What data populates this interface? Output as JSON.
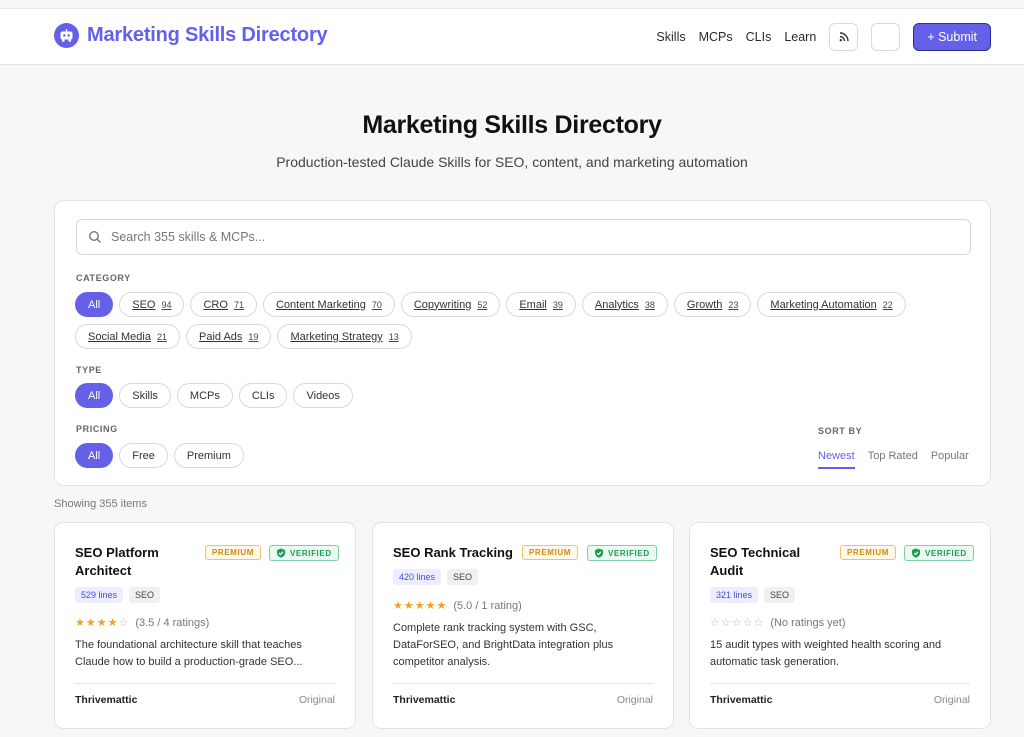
{
  "header": {
    "brand_title": "Marketing Skills Directory",
    "nav": [
      "Skills",
      "MCPs",
      "CLIs",
      "Learn"
    ],
    "rss_icon": "rss-icon",
    "theme_icon": "moon-icon",
    "submit_label": "+ Submit"
  },
  "hero": {
    "title": "Marketing Skills Directory",
    "subtitle": "Production-tested Claude Skills for SEO, content, and marketing automation"
  },
  "search": {
    "placeholder": "Search 355 skills & MCPs..."
  },
  "filters": {
    "category_label": "CATEGORY",
    "categories": [
      {
        "label": "All",
        "count": ""
      },
      {
        "label": "SEO",
        "count": "94"
      },
      {
        "label": "CRO",
        "count": "71"
      },
      {
        "label": "Content Marketing",
        "count": "70"
      },
      {
        "label": "Copywriting",
        "count": "52"
      },
      {
        "label": "Email",
        "count": "39"
      },
      {
        "label": "Analytics",
        "count": "38"
      },
      {
        "label": "Growth",
        "count": "23"
      },
      {
        "label": "Marketing Automation",
        "count": "22"
      },
      {
        "label": "Social Media",
        "count": "21"
      },
      {
        "label": "Paid Ads",
        "count": "19"
      },
      {
        "label": "Marketing Strategy",
        "count": "13"
      }
    ],
    "type_label": "TYPE",
    "types": [
      "All",
      "Skills",
      "MCPs",
      "CLIs",
      "Videos"
    ],
    "pricing_label": "PRICING",
    "pricing": [
      "All",
      "Free",
      "Premium"
    ],
    "sort_label": "SORT BY",
    "sort_options": [
      "Newest",
      "Top Rated",
      "Popular"
    ]
  },
  "showing": "Showing 355 items",
  "colors": {
    "accent": "#6461e8",
    "premium": "#d08a12",
    "verified": "#1f9a55",
    "star": "#f0a020"
  },
  "cards": [
    {
      "title": "SEO Platform Architect",
      "premium": "PREMIUM",
      "verified": "VERIFIED",
      "lines": "529 lines",
      "tag": "SEO",
      "stars": "★★★★",
      "stars_empty": "☆",
      "rating_text": "(3.5 / 4 ratings)",
      "description": "The foundational architecture skill that teaches Claude how to build a production-grade SEO...",
      "author": "Thrivemattic",
      "origin": "Original"
    },
    {
      "title": "SEO Rank Tracking",
      "premium": "PREMIUM",
      "verified": "VERIFIED",
      "lines": "420 lines",
      "tag": "SEO",
      "stars": "★★★★★",
      "stars_empty": "",
      "rating_text": "(5.0 / 1 rating)",
      "description": "Complete rank tracking system with GSC, DataForSEO, and BrightData integration plus competitor analysis.",
      "author": "Thrivemattic",
      "origin": "Original"
    },
    {
      "title": "SEO Technical Audit",
      "premium": "PREMIUM",
      "verified": "VERIFIED",
      "lines": "321 lines",
      "tag": "SEO",
      "stars": "",
      "stars_empty": "☆☆☆☆☆",
      "rating_text": "(No ratings yet)",
      "description": "15 audit types with weighted health scoring and automatic task generation.",
      "author": "Thrivemattic",
      "origin": "Original"
    }
  ]
}
